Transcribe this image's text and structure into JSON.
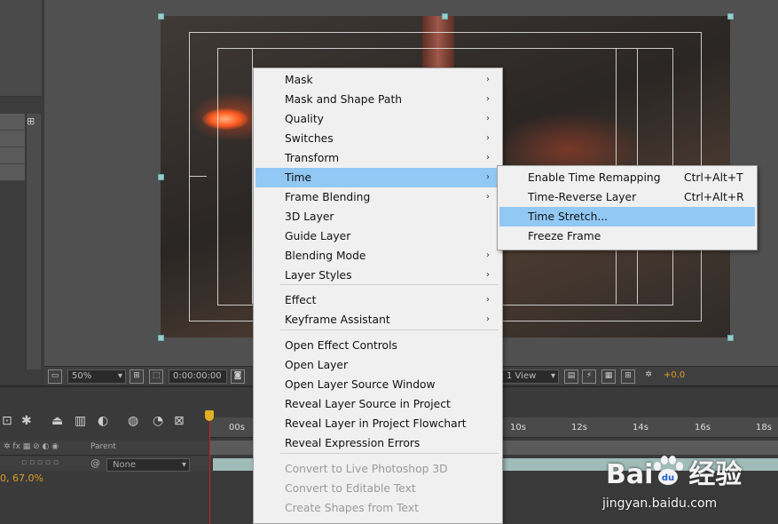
{
  "context_menu": {
    "items": [
      {
        "label": "Mask",
        "submenu": true
      },
      {
        "label": "Mask and Shape Path",
        "submenu": true
      },
      {
        "label": "Quality",
        "submenu": true
      },
      {
        "label": "Switches",
        "submenu": true
      },
      {
        "label": "Transform",
        "submenu": true
      },
      {
        "label": "Time",
        "submenu": true,
        "highlighted": true
      },
      {
        "label": "Frame Blending",
        "submenu": true
      },
      {
        "label": "3D Layer",
        "submenu": false
      },
      {
        "label": "Guide Layer",
        "submenu": false
      },
      {
        "label": "Blending Mode",
        "submenu": true
      },
      {
        "label": "Layer Styles",
        "submenu": true
      },
      {
        "label": "Effect",
        "submenu": true
      },
      {
        "label": "Keyframe Assistant",
        "submenu": true
      },
      {
        "label": "Open Effect Controls",
        "submenu": false
      },
      {
        "label": "Open Layer",
        "submenu": false
      },
      {
        "label": "Open Layer Source Window",
        "submenu": false
      },
      {
        "label": "Reveal Layer Source in Project",
        "submenu": false
      },
      {
        "label": "Reveal Layer in Project Flowchart",
        "submenu": false
      },
      {
        "label": "Reveal Expression Errors",
        "submenu": false
      },
      {
        "label": "Convert to Live Photoshop 3D",
        "submenu": false,
        "disabled": true
      },
      {
        "label": "Convert to Editable Text",
        "submenu": false,
        "disabled": true
      },
      {
        "label": "Create Shapes from Text",
        "submenu": false,
        "disabled": true
      }
    ],
    "arrow_glyph": "›"
  },
  "time_submenu": {
    "items": [
      {
        "label": "Enable Time Remapping",
        "shortcut": "Ctrl+Alt+T"
      },
      {
        "label": "Time-Reverse Layer",
        "shortcut": "Ctrl+Alt+R"
      },
      {
        "label": "Time Stretch...",
        "shortcut": "",
        "highlighted": true
      },
      {
        "label": "Freeze Frame",
        "shortcut": ""
      }
    ]
  },
  "viewer_toolbar": {
    "zoom": "50%",
    "timecode": "0:00:00:00",
    "view_layout": "1 View",
    "exposure": "+0.0"
  },
  "timeline": {
    "parent_header": "Parent",
    "parent_value": "None",
    "scale_value": "0, 67.0%",
    "ruler_ticks": [
      "00s",
      "10s",
      "12s",
      "14s",
      "16s",
      "18s"
    ]
  },
  "watermark": {
    "logo": "Bai",
    "logo_suffix": "经验",
    "url": "jingyan.baidu.com"
  },
  "colors": {
    "menu_highlight": "#92c8f4",
    "menu_bg": "#f0f0f0",
    "playhead": "#d02020",
    "accent_orange": "#e0a020"
  }
}
